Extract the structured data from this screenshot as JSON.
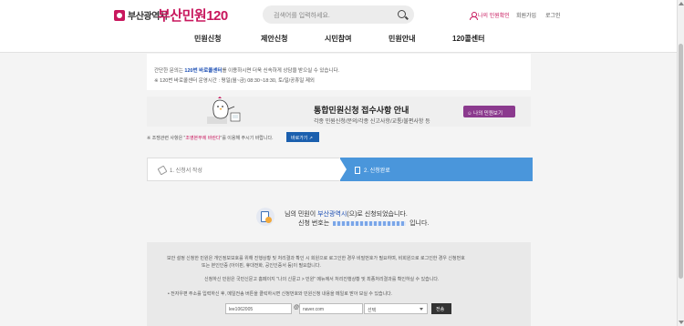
{
  "header": {
    "org_name": "부산광역시",
    "service_name": "부산민원120",
    "search_placeholder": "검색어를 입력하세요.",
    "my_complaints": "나의 민원확인",
    "join": "회원가입",
    "login": "로그인",
    "nav": [
      "민원신청",
      "제안신청",
      "시민참여",
      "민원안내",
      "120콜센터"
    ]
  },
  "notice": {
    "line1_pre": "간단한 문의는 ",
    "line1_highlight": "120번 바로콜센터",
    "line1_post": "를 이용하시면 더욱 신속하게 상담을 받으실 수 있습니다.",
    "line2": "※ 120번 바로콜센터 운영시간 : 평일(월~금) 08:30~18:30, 토/일/공휴일 제외"
  },
  "banner": {
    "title": "통합민원신청 접수사항 안내",
    "subtitle": "각종 민원신청/문의/각종 신고사항/교통/불편사항 등",
    "button": "나의 민원보기"
  },
  "report_note": {
    "pre": "※ 조쟁관련 사항은 \"",
    "highlight": "조영본부에 바란다",
    "post": "\"를 이용해 주시기 바랍니다."
  },
  "link_button": "바로가기",
  "steps": {
    "step1": "1. 신청서 작성",
    "step2": "2. 신청완료"
  },
  "completion": {
    "line1_pre": "님의 민원이 ",
    "line1_highlight": "부산광역시",
    "line1_post": "(으)로 신청되었습니다.",
    "line2_pre": "신청 번호는",
    "line2_post": "입니다."
  },
  "info": {
    "p1": "보안 설정 신청한 민원은 개인정보보호를 위해 진행상황 및 처리결과 확인 시 회원으로 로그인한 경우 비밀번호가 필요하며, 비회원으로 로그인한 경우 신청번호",
    "p2": "또는 본인인증 (아이핀, 휴대전화, 공인인증서 등)이 필요합니다.",
    "p3": "신청하신 민원은 국민신문고 홈페이지 \"나의 신문고 > 민원\" 메뉴에서 처리진행상황 및 최종처리결과를 확인하실 수 있습니다.",
    "p4": "• 전자우편 주소를 입력하신 후, 메일전송 버튼을 클릭하시면 신청번호와 민원신청 내용을 메일로 받아 보실 수 있습니다.",
    "email_id": "lee1062005",
    "email_at": "@",
    "email_domain": "naver.com",
    "domain_select": "선택",
    "send_button": "전송"
  }
}
